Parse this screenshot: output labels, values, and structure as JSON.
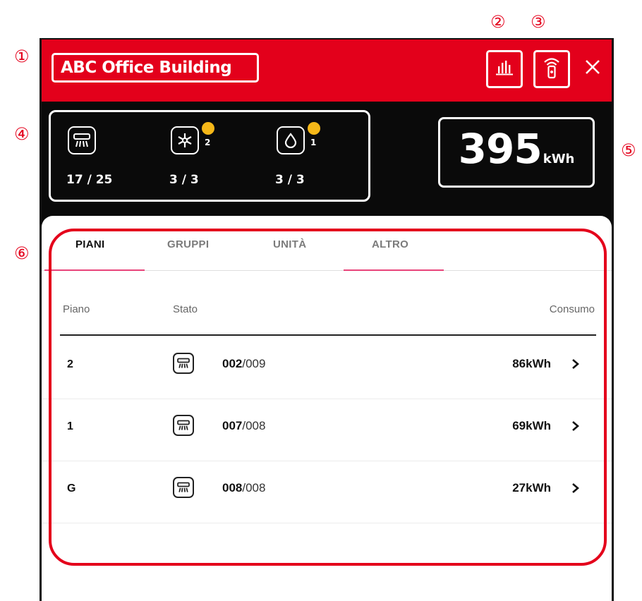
{
  "callouts": [
    "①",
    "②",
    "③",
    "④",
    "⑤",
    "⑥"
  ],
  "header": {
    "title": "ABC Office Building",
    "icons": [
      "bar-chart-icon",
      "wifi-remote-icon",
      "close-icon"
    ],
    "colors": {
      "header_bg": "#e3001b",
      "highlight": "#ffffff"
    }
  },
  "summary": {
    "ac_units": {
      "icon": "air-conditioner-icon",
      "value": "17 / 25"
    },
    "cooling": {
      "icon": "snowflake-icon",
      "alert_count": "2",
      "value": "3 / 3"
    },
    "dry": {
      "icon": "water-drop-icon",
      "alert_count": "1",
      "value": "3 / 3"
    },
    "energy": {
      "value": "395",
      "unit": "kWh"
    },
    "colors": {
      "bg": "#0a0a0a",
      "badge": "#f5b718"
    }
  },
  "tabs": [
    {
      "label": "PIANI",
      "active": true
    },
    {
      "label": "GRUPPI",
      "active": false
    },
    {
      "label": "UNITÀ",
      "active": false
    },
    {
      "label": "ALTRO",
      "active": false
    }
  ],
  "table": {
    "headers": {
      "floor": "Piano",
      "status": "Stato",
      "consumption": "Consumo"
    },
    "rows": [
      {
        "floor": "2",
        "active": "002",
        "total": "/009",
        "consumption": "86kWh"
      },
      {
        "floor": "1",
        "active": "007",
        "total": "/008",
        "consumption": "69kWh"
      },
      {
        "floor": "G",
        "active": "008",
        "total": "/008",
        "consumption": "27kWh"
      }
    ]
  },
  "accent_colors": {
    "callout_red": "#e4001b",
    "tab_underline": "#e8447a"
  }
}
